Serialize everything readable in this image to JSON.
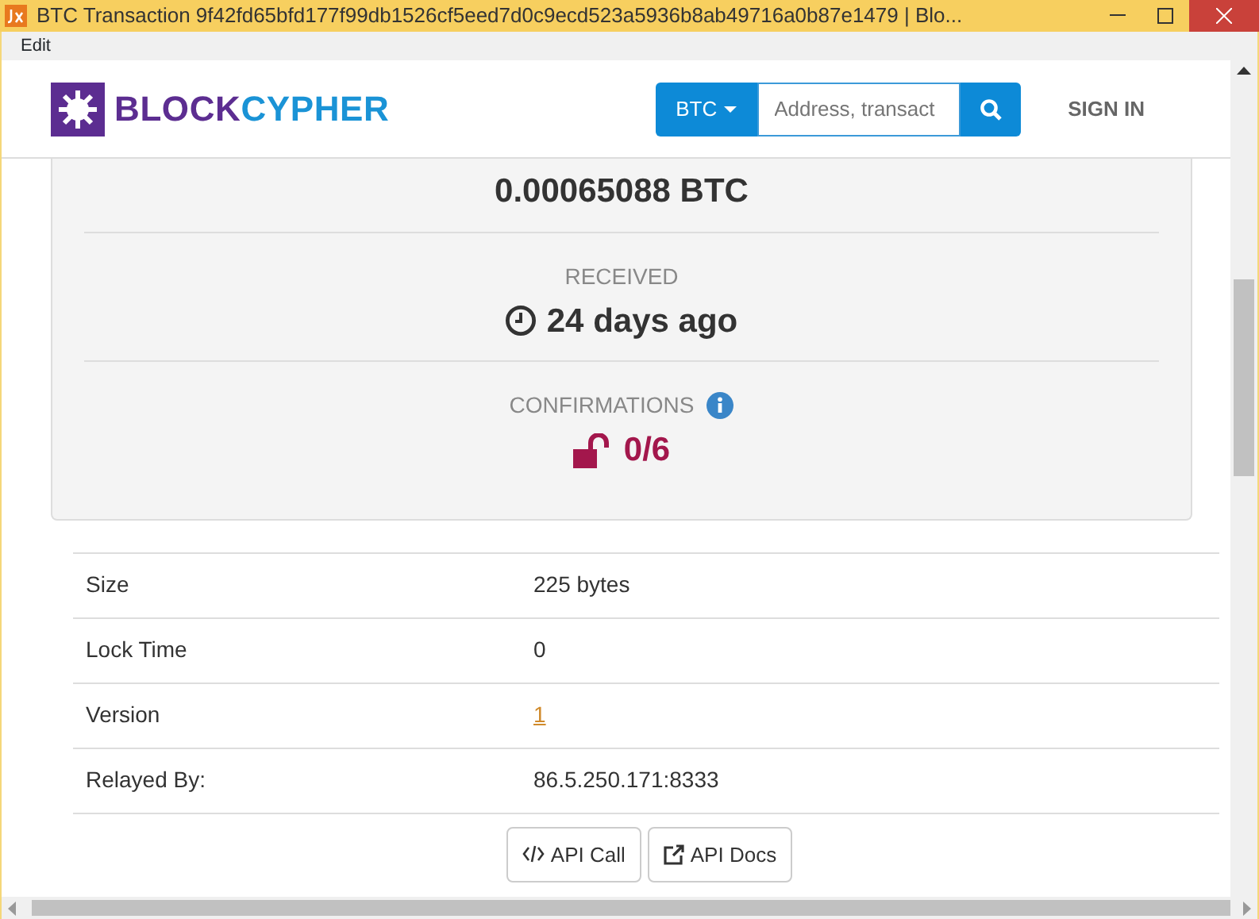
{
  "window": {
    "title": "BTC Transaction 9f42fd65bfd177f99db1526cf5eed7d0c9ecd523a5936b8ab49716a0b87e1479 | Blo..."
  },
  "menu": [
    "Edit"
  ],
  "navbar": {
    "logo_parts": [
      "BLOCK",
      "CYPHER"
    ],
    "currency": "BTC",
    "search": {
      "placeholder": "Address, transact"
    },
    "sign_in": "SIGN IN"
  },
  "summary": {
    "amount": "0.00065088 BTC",
    "received_label": "RECEIVED",
    "received_value": "24 days ago",
    "confirmations_label": "CONFIRMATIONS",
    "confirmations_value": "0/6"
  },
  "details": [
    {
      "label": "Size",
      "value": "225 bytes",
      "kind": "plain"
    },
    {
      "label": "Lock Time",
      "value": "0",
      "kind": "plain"
    },
    {
      "label": "Version",
      "value": "1",
      "kind": "link"
    },
    {
      "label": "Relayed By:",
      "value": "86.5.250.171:8333",
      "kind": "plain"
    }
  ],
  "buttons": [
    {
      "label": "API Call",
      "kind": "code"
    },
    {
      "label": "API Docs",
      "kind": "external"
    }
  ]
}
